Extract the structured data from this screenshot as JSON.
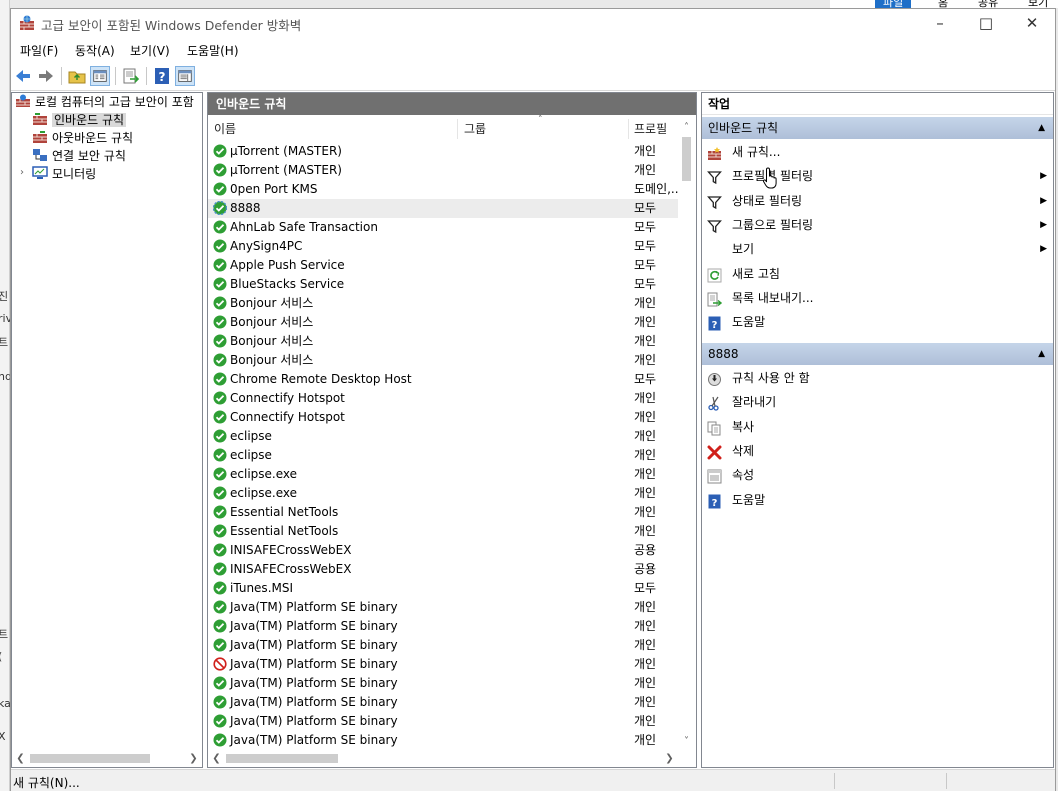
{
  "window": {
    "title": "고급 보안이 포함된 Windows Defender 방화벽"
  },
  "menus": [
    "파일(F)",
    "동작(A)",
    "보기(V)",
    "도움말(H)"
  ],
  "tree": {
    "root": "로컬 컴퓨터의 고급 보안이 포함",
    "items": [
      "인바운드 규칙",
      "아웃바운드 규칙",
      "연결 보안 규칙",
      "모니터링"
    ]
  },
  "center": {
    "header": "인바운드 규칙",
    "columns": {
      "name": "이름",
      "group": "그룹",
      "profile": "프로필"
    },
    "rows": [
      {
        "name": "µTorrent (MASTER)",
        "profile": "개인",
        "status": "allow"
      },
      {
        "name": "µTorrent (MASTER)",
        "profile": "개인",
        "status": "allow"
      },
      {
        "name": "0pen Port KMS",
        "profile": "도메인,...",
        "status": "allow"
      },
      {
        "name": "8888",
        "profile": "모두",
        "status": "allow-secure"
      },
      {
        "name": "AhnLab Safe Transaction",
        "profile": "모두",
        "status": "allow"
      },
      {
        "name": "AnySign4PC",
        "profile": "모두",
        "status": "allow"
      },
      {
        "name": "Apple Push Service",
        "profile": "모두",
        "status": "allow"
      },
      {
        "name": "BlueStacks Service",
        "profile": "모두",
        "status": "allow"
      },
      {
        "name": "Bonjour 서비스",
        "profile": "개인",
        "status": "allow"
      },
      {
        "name": "Bonjour 서비스",
        "profile": "개인",
        "status": "allow"
      },
      {
        "name": "Bonjour 서비스",
        "profile": "개인",
        "status": "allow"
      },
      {
        "name": "Bonjour 서비스",
        "profile": "개인",
        "status": "allow"
      },
      {
        "name": "Chrome Remote Desktop Host",
        "profile": "모두",
        "status": "allow"
      },
      {
        "name": "Connectify Hotspot",
        "profile": "개인",
        "status": "allow"
      },
      {
        "name": "Connectify Hotspot",
        "profile": "개인",
        "status": "allow"
      },
      {
        "name": "eclipse",
        "profile": "개인",
        "status": "allow"
      },
      {
        "name": "eclipse",
        "profile": "개인",
        "status": "allow"
      },
      {
        "name": "eclipse.exe",
        "profile": "개인",
        "status": "allow"
      },
      {
        "name": "eclipse.exe",
        "profile": "개인",
        "status": "allow"
      },
      {
        "name": "Essential NetTools",
        "profile": "개인",
        "status": "allow"
      },
      {
        "name": "Essential NetTools",
        "profile": "개인",
        "status": "allow"
      },
      {
        "name": "INISAFECrossWebEX",
        "profile": "공용",
        "status": "allow"
      },
      {
        "name": "INISAFECrossWebEX",
        "profile": "공용",
        "status": "allow"
      },
      {
        "name": "iTunes.MSI",
        "profile": "모두",
        "status": "allow"
      },
      {
        "name": "Java(TM) Platform SE binary",
        "profile": "개인",
        "status": "allow"
      },
      {
        "name": "Java(TM) Platform SE binary",
        "profile": "개인",
        "status": "allow"
      },
      {
        "name": "Java(TM) Platform SE binary",
        "profile": "개인",
        "status": "allow"
      },
      {
        "name": "Java(TM) Platform SE binary",
        "profile": "개인",
        "status": "block"
      },
      {
        "name": "Java(TM) Platform SE binary",
        "profile": "개인",
        "status": "allow"
      },
      {
        "name": "Java(TM) Platform SE binary",
        "profile": "개인",
        "status": "allow"
      },
      {
        "name": "Java(TM) Platform SE binary",
        "profile": "개인",
        "status": "allow"
      },
      {
        "name": "Java(TM) Platform SE binary",
        "profile": "개인",
        "status": "allow"
      }
    ]
  },
  "actions": {
    "title": "작업",
    "section1": {
      "header": "인바운드 규칙",
      "items": [
        {
          "label": "새 규칙...",
          "icon": "new-rule-icon",
          "submenu": false
        },
        {
          "label": "프로필별 필터링",
          "icon": "filter-icon",
          "submenu": true
        },
        {
          "label": "상태로 필터링",
          "icon": "filter-icon",
          "submenu": true
        },
        {
          "label": "그룹으로 필터링",
          "icon": "filter-icon",
          "submenu": true
        },
        {
          "label": "보기",
          "icon": "",
          "submenu": true
        },
        {
          "label": "새로 고침",
          "icon": "refresh-icon",
          "submenu": false
        },
        {
          "label": "목록 내보내기...",
          "icon": "export-icon",
          "submenu": false
        },
        {
          "label": "도움말",
          "icon": "help-icon",
          "submenu": false
        }
      ]
    },
    "section2": {
      "header": "8888",
      "items": [
        {
          "label": "규칙 사용 안 함",
          "icon": "disable-icon"
        },
        {
          "label": "잘라내기",
          "icon": "cut-icon"
        },
        {
          "label": "복사",
          "icon": "copy-icon"
        },
        {
          "label": "삭제",
          "icon": "delete-icon"
        },
        {
          "label": "속성",
          "icon": "properties-icon"
        },
        {
          "label": "도움말",
          "icon": "help-icon"
        }
      ]
    }
  },
  "status": {
    "text": "새 규칙(N)..."
  },
  "background": {
    "tabs": [
      "파일",
      "홈",
      "공유",
      "보기"
    ],
    "left_fragments": [
      "진",
      "riv",
      "트",
      "nd",
      "트",
      "(",
      "ka",
      "X"
    ]
  },
  "colors": {
    "allow": "#2e9e34",
    "block": "#d0201b",
    "header_bg": "#707070",
    "section_bg": "#b7c8de"
  }
}
